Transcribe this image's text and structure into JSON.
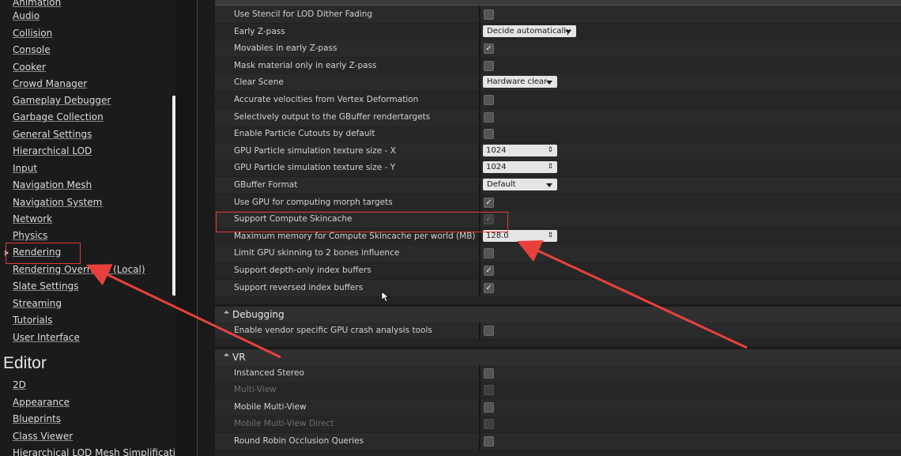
{
  "sidebar": {
    "items": [
      {
        "label": "Animation"
      },
      {
        "label": "Audio"
      },
      {
        "label": "Collision"
      },
      {
        "label": "Console"
      },
      {
        "label": "Cooker"
      },
      {
        "label": "Crowd Manager"
      },
      {
        "label": "Gameplay Debugger"
      },
      {
        "label": "Garbage Collection"
      },
      {
        "label": "General Settings"
      },
      {
        "label": "Hierarchical LOD"
      },
      {
        "label": "Input"
      },
      {
        "label": "Navigation Mesh"
      },
      {
        "label": "Navigation System"
      },
      {
        "label": "Network"
      },
      {
        "label": "Physics"
      },
      {
        "label": "Rendering"
      },
      {
        "label": "Rendering Overrides (Local)"
      },
      {
        "label": "Slate Settings"
      },
      {
        "label": "Streaming"
      },
      {
        "label": "Tutorials"
      },
      {
        "label": "User Interface"
      }
    ],
    "editor_heading": "Editor",
    "editor_items": [
      {
        "label": "2D"
      },
      {
        "label": "Appearance"
      },
      {
        "label": "Blueprints"
      },
      {
        "label": "Class Viewer"
      },
      {
        "label": "Hierarchical LOD Mesh Simplification"
      }
    ]
  },
  "rendering_rows": [
    {
      "label": "Use Stencil for LOD Dither Fading",
      "control": "checkbox",
      "checked": false
    },
    {
      "label": "Early Z-pass",
      "control": "dropdown",
      "value": "Decide automatically"
    },
    {
      "label": "Movables in early Z-pass",
      "control": "checkbox",
      "checked": true
    },
    {
      "label": "Mask material only in early Z-pass",
      "control": "checkbox",
      "checked": false
    },
    {
      "label": "Clear Scene",
      "control": "dropdown",
      "value": "Hardware clear"
    },
    {
      "label": "Accurate velocities from Vertex Deformation",
      "control": "checkbox",
      "checked": false
    },
    {
      "label": "Selectively output to the GBuffer rendertargets",
      "control": "checkbox",
      "checked": false
    },
    {
      "label": "Enable Particle Cutouts by default",
      "control": "checkbox",
      "checked": false
    },
    {
      "label": "GPU Particle simulation texture size - X",
      "control": "number",
      "value": "1024"
    },
    {
      "label": "GPU Particle simulation texture size - Y",
      "control": "number",
      "value": "1024"
    },
    {
      "label": "GBuffer Format",
      "control": "dropdown",
      "value": "Default"
    },
    {
      "label": "Use GPU for computing morph targets",
      "control": "checkbox",
      "checked": true
    },
    {
      "label": "Support Compute Skincache",
      "control": "checkbox",
      "checked": true,
      "dim": true
    },
    {
      "label": "Maximum memory for Compute Skincache per world (MB)",
      "control": "number",
      "value": "128.0"
    },
    {
      "label": "Limit GPU skinning to 2 bones influence",
      "control": "checkbox",
      "checked": false
    },
    {
      "label": "Support depth-only index buffers",
      "control": "checkbox",
      "checked": true
    },
    {
      "label": "Support reversed index buffers",
      "control": "checkbox",
      "checked": true
    }
  ],
  "debugging": {
    "title": "Debugging",
    "rows": [
      {
        "label": "Enable vendor specific GPU crash analysis tools",
        "control": "checkbox",
        "checked": false
      }
    ]
  },
  "vr": {
    "title": "VR",
    "rows": [
      {
        "label": "Instanced Stereo",
        "control": "checkbox",
        "checked": false
      },
      {
        "label": "Multi-View",
        "control": "checkbox",
        "checked": false,
        "disabled": true
      },
      {
        "label": "Mobile Multi-View",
        "control": "checkbox",
        "checked": false
      },
      {
        "label": "Mobile Multi-View Direct",
        "control": "checkbox",
        "checked": false,
        "disabled": true
      },
      {
        "label": "Round Robin Occlusion Queries",
        "control": "checkbox",
        "checked": false
      }
    ]
  },
  "glyphs": {
    "check": "✓",
    "spin": "⇕"
  },
  "colors": {
    "highlight": "#e03a3a",
    "arrow": "#e8413c"
  }
}
